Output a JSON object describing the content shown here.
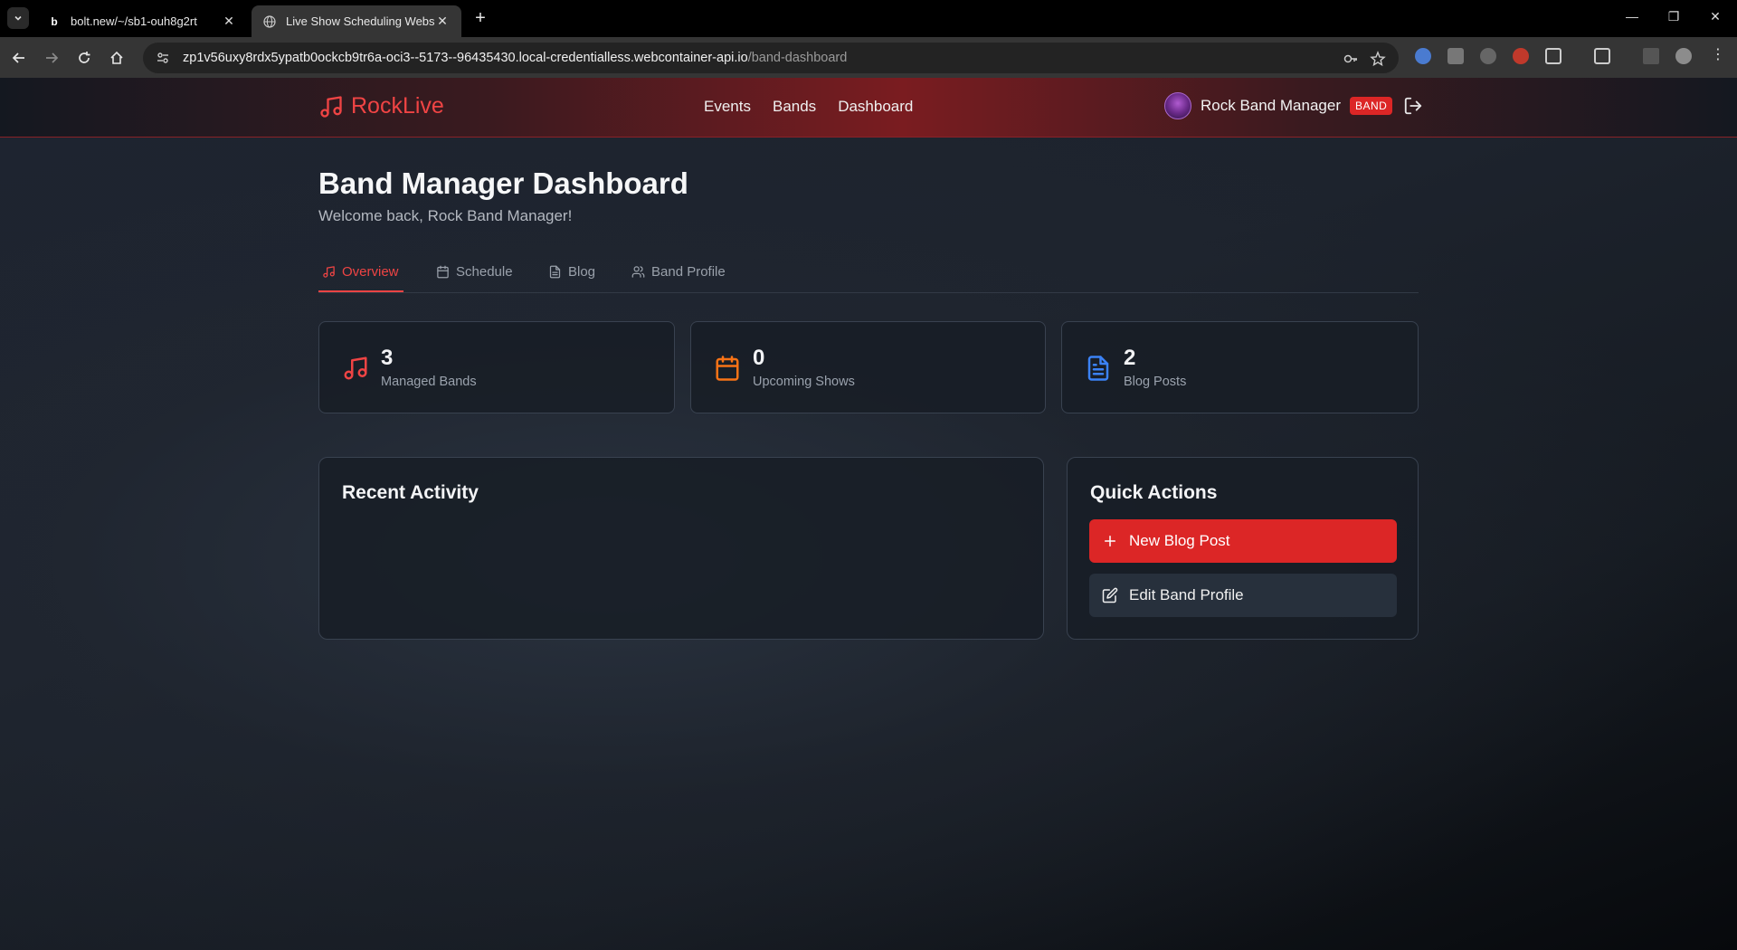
{
  "browser": {
    "tabs": [
      {
        "title": "bolt.new/~/sb1-ouh8g2rt",
        "favicon": "b"
      },
      {
        "title": "Live Show Scheduling Website",
        "favicon": "globe"
      }
    ],
    "url_host": "zp1v56uxy8rdx5ypatb0ockcb9tr6a-oci3--5173--96435430.local-credentialless.webcontainer-api.io",
    "url_path": "/band-dashboard"
  },
  "header": {
    "brand": "RockLive",
    "nav": [
      "Events",
      "Bands",
      "Dashboard"
    ],
    "user_name": "Rock Band Manager",
    "role_badge": "BAND"
  },
  "page": {
    "title": "Band Manager Dashboard",
    "subtitle": "Welcome back, Rock Band Manager!"
  },
  "tabs": [
    {
      "label": "Overview",
      "icon": "music-icon",
      "active": true
    },
    {
      "label": "Schedule",
      "icon": "calendar-icon",
      "active": false
    },
    {
      "label": "Blog",
      "icon": "document-icon",
      "active": false
    },
    {
      "label": "Band Profile",
      "icon": "users-icon",
      "active": false
    }
  ],
  "stats": [
    {
      "value": "3",
      "label": "Managed Bands",
      "icon": "music-icon",
      "color": "#ef4444"
    },
    {
      "value": "0",
      "label": "Upcoming Shows",
      "icon": "calendar-icon",
      "color": "#f97316"
    },
    {
      "value": "2",
      "label": "Blog Posts",
      "icon": "document-icon",
      "color": "#3b82f6"
    }
  ],
  "recent_activity": {
    "title": "Recent Activity"
  },
  "quick_actions": {
    "title": "Quick Actions",
    "primary": "New Blog Post",
    "secondary": "Edit Band Profile"
  },
  "colors": {
    "accent": "#dc2626",
    "brand": "#ef4444"
  }
}
